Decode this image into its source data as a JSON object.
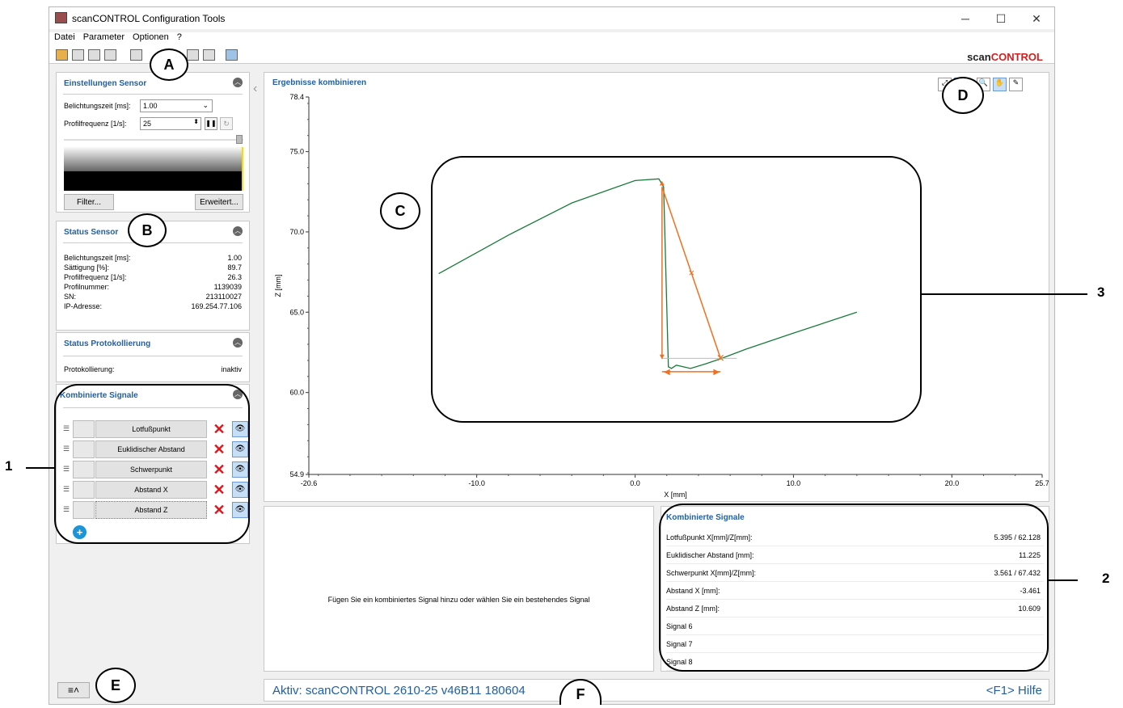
{
  "window": {
    "title": "scanCONTROL Configuration Tools",
    "minimize": "─",
    "maximize": "☐",
    "close": "✕"
  },
  "menu": [
    "Datei",
    "Parameter",
    "Optionen",
    "?"
  ],
  "brand": {
    "prefix": "scan",
    "suffix": "CONTROL"
  },
  "sensor_settings": {
    "title": "Einstellungen Sensor",
    "exposure_label": "Belichtungszeit [ms]:",
    "exposure_value": "1.00",
    "freq_label": "Profilfrequenz [1/s]:",
    "freq_value": "25",
    "filter_button": "Filter...",
    "advanced_button": "Erweitert..."
  },
  "status_sensor": {
    "title": "Status Sensor",
    "rows": [
      {
        "label": "Belichtungszeit [ms]:",
        "value": "1.00"
      },
      {
        "label": "Sättigung [%]:",
        "value": "89.7"
      },
      {
        "label": "Profilfrequenz [1/s]:",
        "value": "26.3"
      },
      {
        "label": "Profilnummer:",
        "value": "1139039"
      },
      {
        "label": "SN:",
        "value": "213110027"
      },
      {
        "label": "IP-Adresse:",
        "value": "169.254.77.106"
      }
    ]
  },
  "status_logging": {
    "title": "Status Protokollierung",
    "label": "Protokollierung:",
    "value": "inaktiv"
  },
  "combined_signals_panel": {
    "title": "Kombinierte Signale",
    "signals": [
      "Lotfußpunkt",
      "Euklidischer Abstand",
      "Schwerpunkt",
      "Abstand X",
      "Abstand Z"
    ]
  },
  "result_panel": {
    "title": "Ergebnisse kombinieren"
  },
  "chart_data": {
    "type": "line",
    "title": "",
    "xlabel": "X [mm]",
    "ylabel": "Z [mm]",
    "xlim": [
      -20.6,
      25.7
    ],
    "ylim": [
      54.9,
      78.4
    ],
    "x_ticks": [
      "-20.6",
      "-10.0",
      "0.0",
      "10.0",
      "20.0",
      "25.7"
    ],
    "y_ticks": [
      "78.4",
      "75.0",
      "70.0",
      "65.0",
      "60.0",
      "54.9"
    ],
    "series": [
      {
        "x": [
          -12.4,
          -8,
          -4,
          0,
          1.5,
          1.8,
          2.1,
          2.3,
          2.6,
          3.5,
          4.5,
          5.4,
          7,
          10,
          14
        ],
        "y": [
          67.4,
          69.8,
          71.8,
          73.2,
          73.3,
          72.8,
          61.6,
          61.5,
          61.7,
          61.5,
          61.8,
          62.1,
          62.7,
          63.7,
          65.0
        ],
        "color": "#1a7a3a"
      }
    ],
    "annotations": {
      "lotfusspunkt": [
        5.395,
        62.128
      ],
      "apex": [
        1.7,
        72.8
      ],
      "schwerpunkt": [
        3.561,
        67.432
      ],
      "base_left": [
        1.7,
        61.4
      ],
      "color": "#f07020"
    }
  },
  "hint_text": "Fügen Sie ein kombiniertes Signal hinzu oder wählen Sie ein bestehendes Signal",
  "results": {
    "title": "Kombinierte Signale",
    "rows": [
      {
        "label": "Lotfußpunkt X[mm]/Z[mm]:",
        "value": "5.395 / 62.128"
      },
      {
        "label": "Euklidischer Abstand [mm]:",
        "value": "11.225"
      },
      {
        "label": "Schwerpunkt X[mm]/Z[mm]:",
        "value": "3.561 / 67.432"
      },
      {
        "label": "Abstand X [mm]:",
        "value": "-3.461"
      },
      {
        "label": "Abstand Z [mm]:",
        "value": "10.609"
      },
      {
        "label": "Signal 6",
        "value": ""
      },
      {
        "label": "Signal 7",
        "value": ""
      },
      {
        "label": "Signal 8",
        "value": ""
      }
    ]
  },
  "status_bar": {
    "active": "Aktiv: scanCONTROL 2610-25 v46B11  180604",
    "help": "<F1> Hilfe"
  },
  "callouts": {
    "A": "A",
    "B": "B",
    "C": "C",
    "D": "D",
    "E": "E",
    "F": "F",
    "n1": "1",
    "n2": "2",
    "n3": "3"
  }
}
